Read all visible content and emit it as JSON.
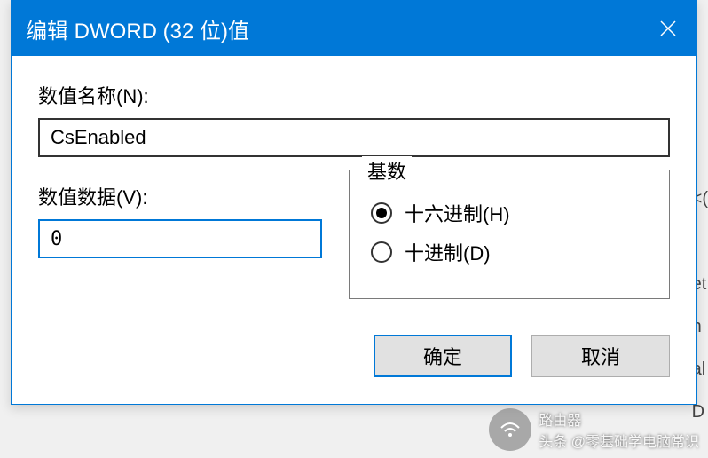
{
  "dialog": {
    "title": "编辑 DWORD (32 位)值",
    "name_label": "数值名称(N):",
    "name_value": "CsEnabled",
    "value_label": "数值数据(V):",
    "value_data": "0",
    "base_group": {
      "legend": "基数",
      "hex_label": "十六进制(H)",
      "dec_label": "十进制(D)",
      "selected": "hex"
    },
    "ok_label": "确定",
    "cancel_label": "取消"
  },
  "watermark": {
    "brand": "路由器",
    "credit": "头条 @零基础学电脑常识"
  }
}
